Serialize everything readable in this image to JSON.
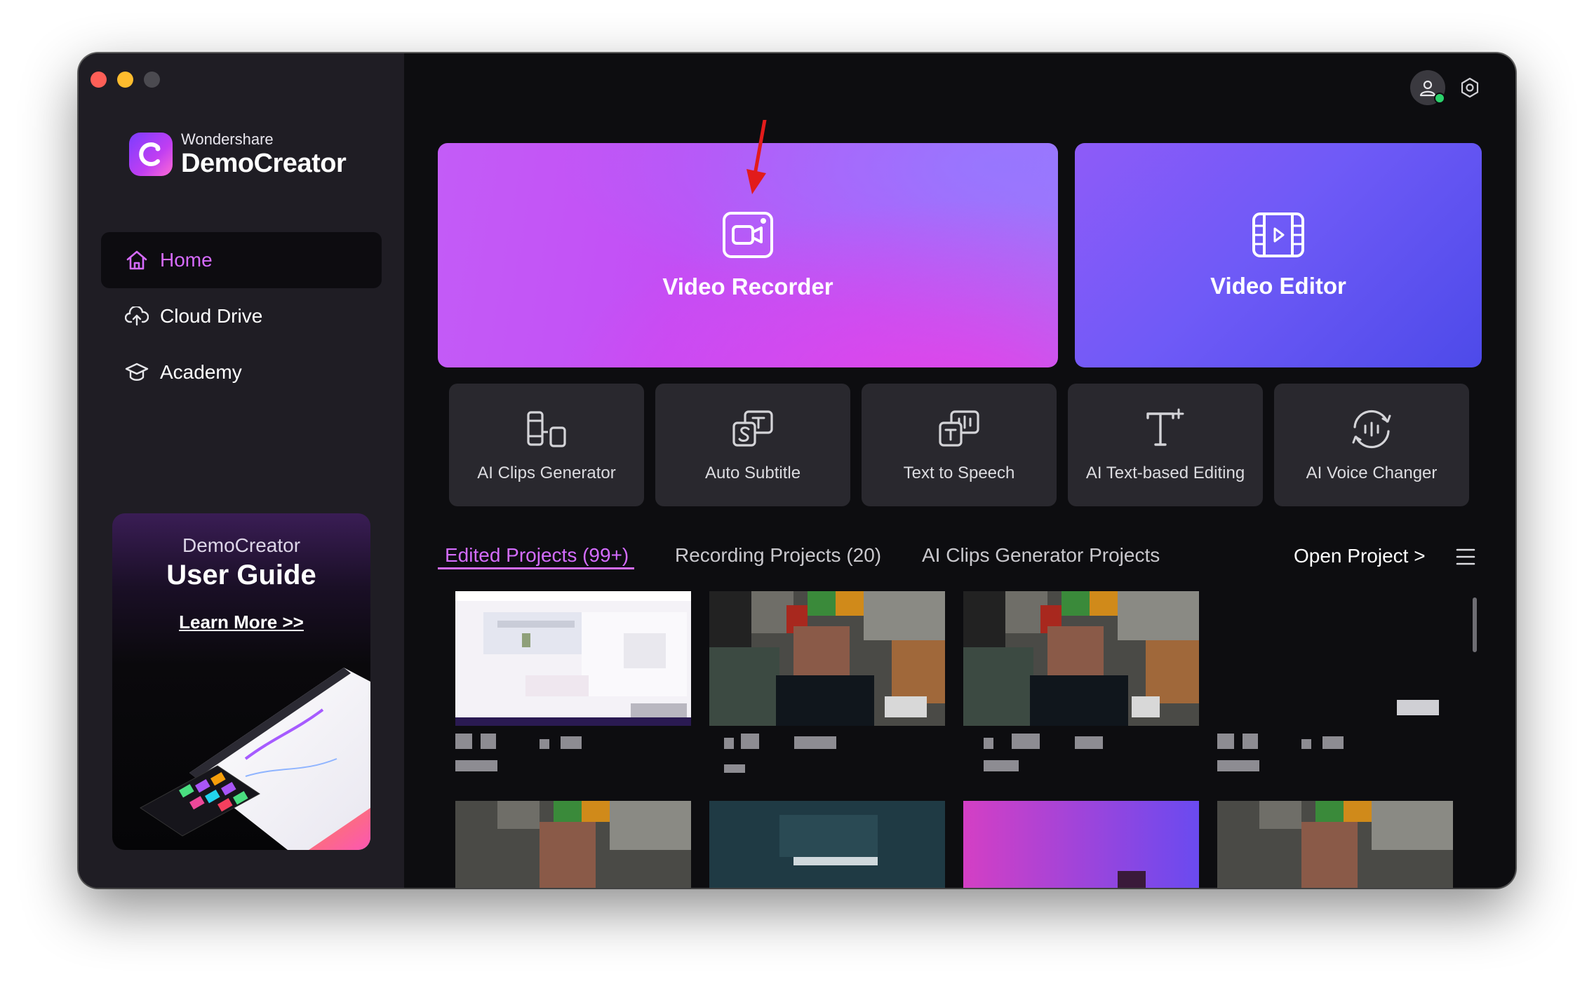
{
  "app": {
    "brand_small": "Wondershare",
    "brand_big": "DemoCreator"
  },
  "sidebar": {
    "items": [
      {
        "label": "Home",
        "icon": "home-icon",
        "active": true
      },
      {
        "label": "Cloud Drive",
        "icon": "cloud-upload-icon",
        "active": false
      },
      {
        "label": "Academy",
        "icon": "graduation-cap-icon",
        "active": false
      }
    ],
    "guide": {
      "brand": "DemoCreator",
      "title": "User Guide",
      "link": "Learn More >>"
    }
  },
  "main": {
    "cards": {
      "recorder": "Video Recorder",
      "editor": "Video Editor"
    },
    "tools": [
      {
        "label": "AI Clips Generator",
        "icon": "clips-generator-icon"
      },
      {
        "label": "Auto Subtitle",
        "icon": "subtitle-icon"
      },
      {
        "label": "Text to Speech",
        "icon": "text-to-speech-icon"
      },
      {
        "label": "AI Text-based Editing",
        "icon": "text-editing-icon"
      },
      {
        "label": "AI Voice Changer",
        "icon": "voice-changer-icon"
      }
    ],
    "tabs": [
      {
        "label": "Edited Projects (99+)",
        "active": true
      },
      {
        "label": "Recording Projects (20)",
        "active": false
      },
      {
        "label": "AI Clips Generator Projects",
        "active": false
      }
    ],
    "open_project": "Open Project >"
  },
  "colors": {
    "accent": "#d46cff",
    "window_bg": "#0d0d10",
    "sidebar_bg": "#1f1d24",
    "tool_bg": "#29282e"
  }
}
